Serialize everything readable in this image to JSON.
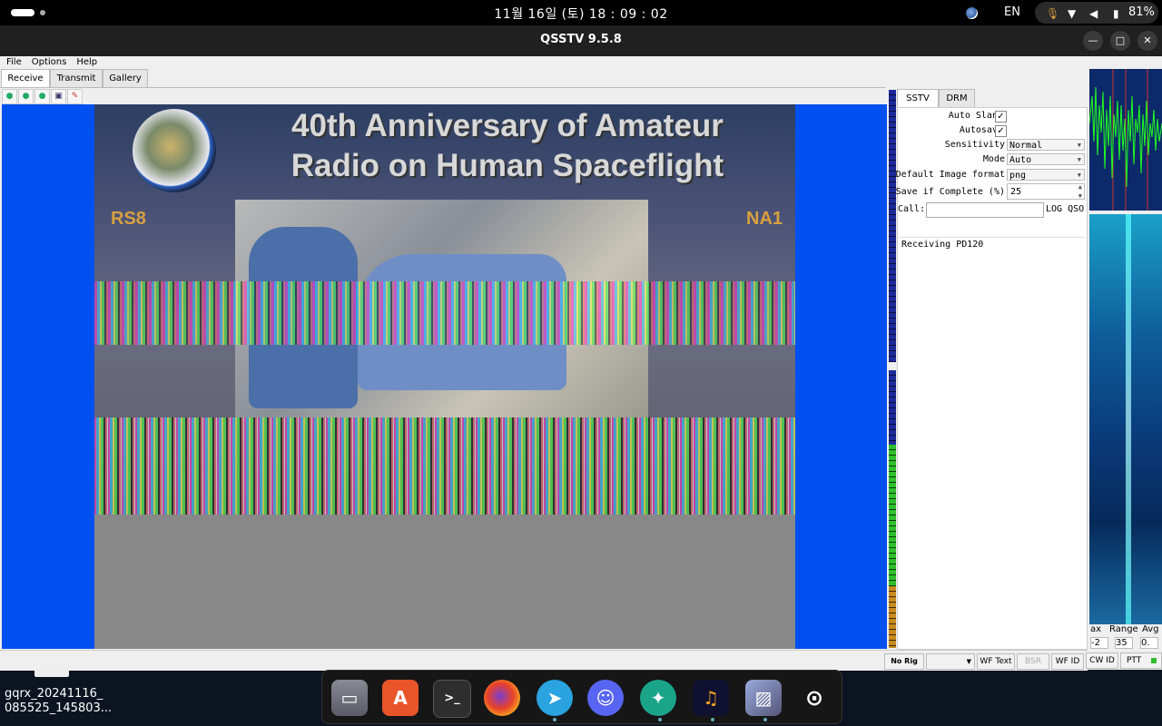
{
  "topbar": {
    "clock": "11월 16일 (토)  18 : 09 : 02",
    "language": "EN",
    "battery": "81%"
  },
  "window": {
    "title": "QSSTV 9.5.8",
    "minimize": "—",
    "maximize": "□",
    "close": "✕"
  },
  "menu": [
    "File",
    "Options",
    "Help"
  ],
  "tabs": [
    "Receive",
    "Transmit",
    "Gallery"
  ],
  "image": {
    "title_line1": "40th Anniversary of Amateur",
    "title_line2": "Radio on Human Spaceflight",
    "left_side": "RS8",
    "right_side": "NA1"
  },
  "right_tabs": [
    "SSTV",
    "DRM"
  ],
  "settings": {
    "auto_slant_label": "Auto Slant",
    "auto_slant": "✓",
    "autosave_label": "Autosave",
    "autosave": "✓",
    "sensitivity_label": "Sensitivity",
    "sensitivity": "Normal",
    "mode_label": "Mode",
    "mode": "Auto",
    "format_label": "Default Image format",
    "format": "png",
    "save_label": "Save if Complete (%)",
    "save_value": "25",
    "call_label": "Call:",
    "log_qso": "LOG QSO",
    "status": "Receiving PD120"
  },
  "statusbar": {
    "rig": "No Rig",
    "wf_text": "WF Text",
    "bsr": "BSR",
    "wf_id": "WF ID",
    "cw_id": "CW ID",
    "ptt": "PTT"
  },
  "waterfall": {
    "max_label": "ax",
    "range_label": "Range",
    "avg_label": "Avg",
    "max_value": "-2",
    "range_value": "35",
    "avg_value": "0."
  },
  "desktop": {
    "file_label": "gqrx_20241116_\n085525_145803..."
  },
  "colors": {
    "image_background": "#0050f0",
    "accent_green": "#2fbf2f"
  }
}
